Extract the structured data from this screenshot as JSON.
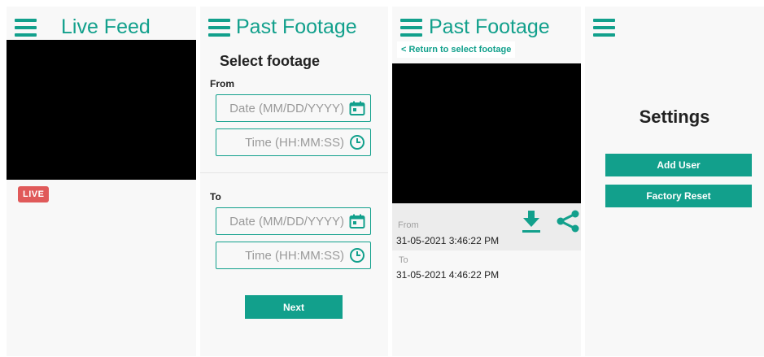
{
  "colors": {
    "accent": "#12a08c",
    "live": "#e05a5a",
    "video": "#000000",
    "screen_bg": "#f8f8f8"
  },
  "live_feed": {
    "title": "Live Feed",
    "badge": "LIVE",
    "menu_icon": "hamburger-menu-icon"
  },
  "past_footage_select": {
    "title": "Past Footage",
    "heading": "Select footage",
    "from_label": "From",
    "to_label": "To",
    "from_date_placeholder": "Date (MM/DD/YYYY)",
    "from_time_placeholder": "Time (HH:MM:SS)",
    "to_date_placeholder": "Date (MM/DD/YYYY)",
    "to_time_placeholder": "Time (HH:MM:SS)",
    "next_label": "Next",
    "icons": {
      "date": "calendar-icon",
      "time": "clock-icon"
    }
  },
  "past_footage_view": {
    "title": "Past Footage",
    "return_link": "< Return to select footage",
    "from_label": "From",
    "from_value": "31-05-2021 3:46:22 PM",
    "to_label": "To",
    "to_value": "31-05-2021 4:46:22 PM",
    "icons": {
      "download": "download-icon",
      "share": "share-icon"
    }
  },
  "settings": {
    "title": "Settings",
    "add_user_label": "Add User",
    "factory_reset_label": "Factory Reset"
  }
}
